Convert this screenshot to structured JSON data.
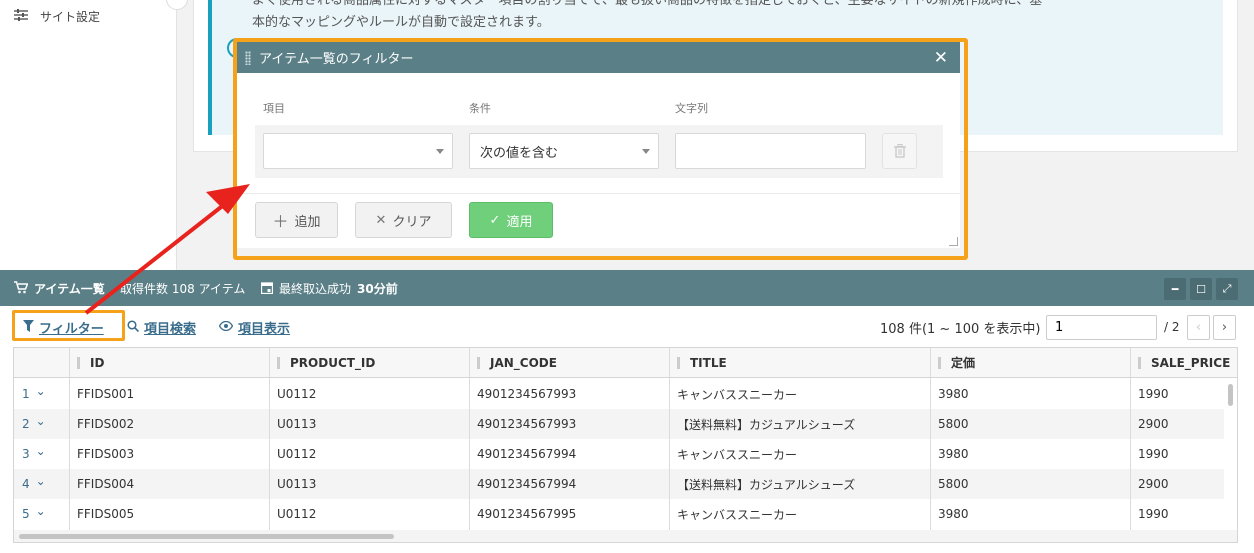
{
  "sidebar": {
    "site_settings": "サイト設定"
  },
  "info": {
    "line1": "よく使用される商品属性に対するマスター項目の割り当てで、最も扱い商品の特徴を指定しておくと、主要なサイトの新規作成時に、基",
    "line2": "本的なマッピングやルールが自動で設定されます。"
  },
  "filter_dialog": {
    "title": "アイテム一覧のフィルター",
    "col_item": "項目",
    "col_condition": "条件",
    "col_text": "文字列",
    "item_value": "",
    "condition_value": "次の値を含む",
    "text_value": "",
    "add_label": "追加",
    "clear_label": "クリア",
    "apply_label": "適用"
  },
  "panel": {
    "title": "アイテム一覧",
    "count_label": "取得件数 108 アイテム",
    "last_import_label": "最終取込成功",
    "last_import_value": "30分前"
  },
  "toolbar": {
    "filter_label": "フィルター",
    "search_label": "項目検索",
    "display_label": "項目表示"
  },
  "pager": {
    "summary": "108 件(1 ~ 100 を表示中)",
    "page_value": "1",
    "total": "/ 2"
  },
  "grid": {
    "columns": [
      "ID",
      "PRODUCT_ID",
      "JAN_CODE",
      "TITLE",
      "定価",
      "SALE_PRICE"
    ],
    "rows": [
      {
        "num": "1",
        "cells": [
          "FFIDS001",
          "U0112",
          "4901234567993",
          "キャンバススニーカー",
          "3980",
          "1990"
        ]
      },
      {
        "num": "2",
        "cells": [
          "FFIDS002",
          "U0113",
          "4901234567993",
          "【送料無料】カジュアルシューズ",
          "5800",
          "2900"
        ]
      },
      {
        "num": "3",
        "cells": [
          "FFIDS003",
          "U0112",
          "4901234567994",
          "キャンバススニーカー",
          "3980",
          "1990"
        ]
      },
      {
        "num": "4",
        "cells": [
          "FFIDS004",
          "U0113",
          "4901234567994",
          "【送料無料】カジュアルシューズ",
          "5800",
          "2900"
        ]
      },
      {
        "num": "5",
        "cells": [
          "FFIDS005",
          "U0112",
          "4901234567995",
          "キャンバススニーカー",
          "3980",
          "1990"
        ]
      }
    ]
  },
  "colors": {
    "header_teal": "#5a7f87",
    "highlight_orange": "#f5a11a",
    "apply_green": "#6fcf7b",
    "annotation_red": "#e8231e",
    "link_blue": "#3a6d8c"
  }
}
